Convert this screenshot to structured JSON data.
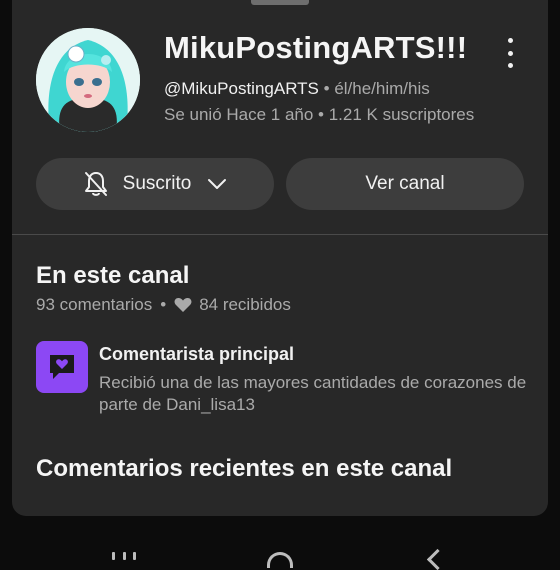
{
  "channel": {
    "title": "MikuPostingARTS!!!",
    "handle": "@MikuPostingARTS",
    "pronouns_separator": "•",
    "pronouns": "él/he/him/his",
    "meta": "Se unió Hace 1 año • 1.21 K suscriptores"
  },
  "buttons": {
    "subscribed_label": "Suscrito",
    "view_channel_label": "Ver canal"
  },
  "on_channel": {
    "title": "En este canal",
    "comments": "93 comentarios",
    "separator": "•",
    "hearts": "84 recibidos"
  },
  "badge": {
    "title": "Comentarista principal",
    "description": "Recibió una de las mayores cantidades de corazones de parte de Dani_lisa13",
    "color": "#8c48f4"
  },
  "recent": {
    "title": "Comentarios recientes en este canal"
  },
  "icons": {
    "more": "more-vert-icon",
    "bell": "bell-off-icon",
    "chevron": "chevron-down-icon",
    "heart": "heart-icon",
    "badge": "heart-message-icon"
  }
}
